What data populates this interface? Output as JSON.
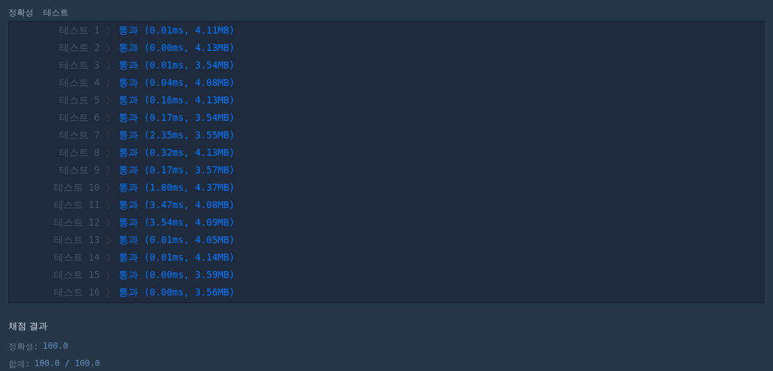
{
  "tabs": [
    {
      "label": "정확성",
      "selected": false
    },
    {
      "label": "테스트",
      "selected": false
    }
  ],
  "results": [
    {
      "label": "테스트 1",
      "result": "통과 (0.01ms, 4.11MB)"
    },
    {
      "label": "테스트 2",
      "result": "통과 (0.00ms, 4.13MB)"
    },
    {
      "label": "테스트 3",
      "result": "통과 (0.01ms, 3.54MB)"
    },
    {
      "label": "테스트 4",
      "result": "통과 (0.04ms, 4.08MB)"
    },
    {
      "label": "테스트 5",
      "result": "통과 (0.16ms, 4.13MB)"
    },
    {
      "label": "테스트 6",
      "result": "통과 (0.17ms, 3.54MB)"
    },
    {
      "label": "테스트 7",
      "result": "통과 (2.35ms, 3.55MB)"
    },
    {
      "label": "테스트 8",
      "result": "통과 (0.32ms, 4.13MB)"
    },
    {
      "label": "테스트 9",
      "result": "통과 (0.17ms, 3.57MB)"
    },
    {
      "label": "테스트 10",
      "result": "통과 (1.80ms, 4.37MB)"
    },
    {
      "label": "테스트 11",
      "result": "통과 (3.47ms, 4.08MB)"
    },
    {
      "label": "테스트 12",
      "result": "통과 (3.54ms, 4.09MB)"
    },
    {
      "label": "테스트 13",
      "result": "통과 (0.01ms, 4.05MB)"
    },
    {
      "label": "테스트 14",
      "result": "통과 (0.01ms, 4.14MB)"
    },
    {
      "label": "테스트 15",
      "result": "통과 (0.00ms, 3.59MB)"
    },
    {
      "label": "테스트 16",
      "result": "통과 (0.00ms, 3.56MB)"
    }
  ],
  "summary": {
    "title": "채점 결과",
    "lines": [
      {
        "label": "정확성:",
        "value": "100.0"
      },
      {
        "label": "합계:",
        "value": "100.0 / 100.0"
      }
    ]
  }
}
